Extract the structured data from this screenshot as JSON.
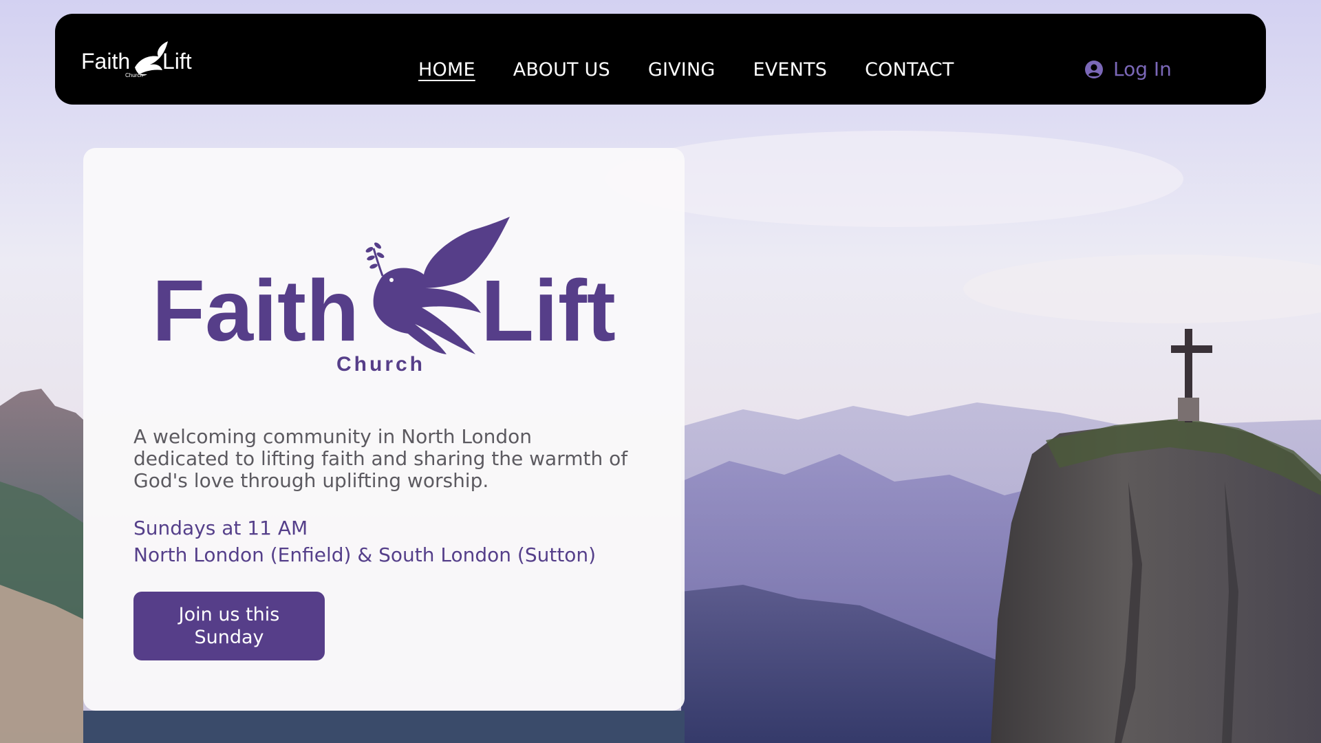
{
  "brand": {
    "name_left": "Faith",
    "name_right": "Lift",
    "tagline": "Church",
    "primary_color": "#563e89",
    "accent_color": "#7b68b8"
  },
  "nav": {
    "items": [
      {
        "label": "HOME",
        "active": true
      },
      {
        "label": "ABOUT US",
        "active": false
      },
      {
        "label": "GIVING",
        "active": false
      },
      {
        "label": "EVENTS",
        "active": false
      },
      {
        "label": "CONTACT",
        "active": false
      }
    ],
    "login": {
      "label": "Log In",
      "icon": "user-circle-icon"
    }
  },
  "hero": {
    "description": "A welcoming community in North London dedicated to lifting faith and sharing the warmth of God's love through uplifting worship.",
    "service_time": "Sundays at 11 AM",
    "locations": "North London (Enfield) & South London (Sutton)",
    "cta_label": "Join us this Sunday"
  },
  "background": {
    "description_icon": "mountain-cross-scene",
    "sky_color": "#d6d3ee"
  }
}
